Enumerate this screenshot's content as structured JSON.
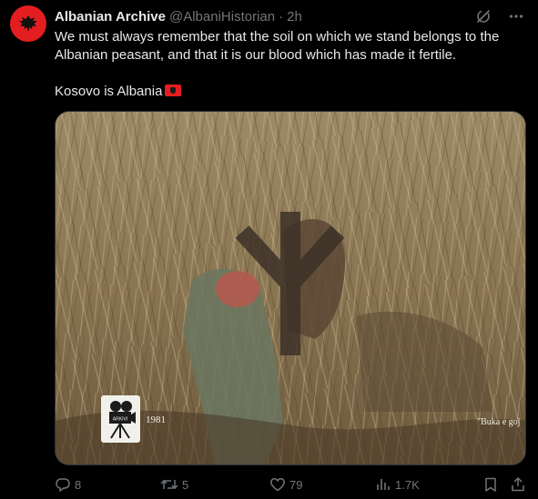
{
  "tweet": {
    "author_name": "Albanian Archive",
    "author_handle": "@AlbaniHistorian",
    "separator": "·",
    "timestamp": "2h",
    "text_line_1": "We must always remember that the soil on which we stand belongs to the Albanian peasant, and that it is our blood which has made it fertile.",
    "text_line_2": "Kosovo is Albania"
  },
  "media": {
    "watermark_logo_text": "ARKIVI",
    "year_label": "1981",
    "subtitle_fragment": "\"Buka e goj"
  },
  "actions": {
    "replies": "8",
    "retweets": "5",
    "likes": "79",
    "views": "1.7K"
  },
  "colors": {
    "background": "#000000",
    "text": "#e7e9ea",
    "muted": "#71767b",
    "flag_red": "#e41e20"
  },
  "icons": [
    "albanian-eagle-icon",
    "grok-icon",
    "more-icon",
    "reply-icon",
    "retweet-icon",
    "like-icon",
    "views-icon",
    "bookmark-icon",
    "share-icon",
    "camera-icon"
  ]
}
